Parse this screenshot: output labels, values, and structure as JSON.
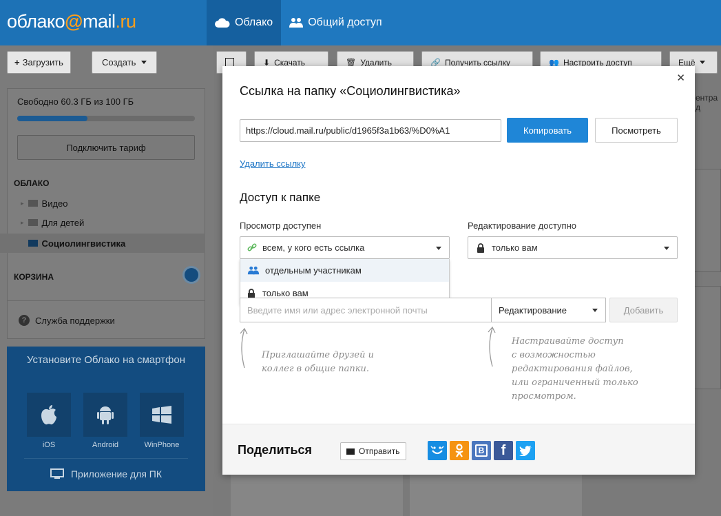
{
  "header": {
    "logo_prefix": "облако",
    "logo_at": "@",
    "logo_mail": "mail",
    "logo_ru": ".ru",
    "nav": [
      {
        "label": "Облако",
        "icon": "cloud-icon"
      },
      {
        "label": "Общий доступ",
        "icon": "people-icon"
      }
    ]
  },
  "sidebar": {
    "upload_label": "Загрузить",
    "create_label": "Создать",
    "storage_text": "Свободно 60.3 ГБ из 100 ГБ",
    "storage_used_fraction": 0.397,
    "tariff_label": "Подключить тариф",
    "cloud_title": "ОБЛАКО",
    "folders": [
      {
        "label": "Видео",
        "selected": false
      },
      {
        "label": "Для детей",
        "selected": false
      },
      {
        "label": "Социолингвистика",
        "selected": true
      }
    ],
    "trash_title": "КОРЗИНА",
    "support_label": "Служба поддержки",
    "promo": {
      "title": "Установите Облако на смартфон",
      "platforms": [
        "iOS",
        "Android",
        "WinPhone"
      ],
      "pc_label": "Приложение для ПК"
    }
  },
  "toolbar": {
    "download_label": "Скачать",
    "delete_label": "Удалить",
    "get_link_label": "Получить ссылку",
    "access_label": "Настроить доступ",
    "more_label": "Ещё",
    "side_text": "ентра д"
  },
  "modal": {
    "title": "Ссылка на папку «Социолингвистика»",
    "url": "https://cloud.mail.ru/public/d1965f3a1b63/%D0%A1",
    "copy_label": "Копировать",
    "view_label": "Посмотреть",
    "delete_link_label": "Удалить ссылку",
    "access_title": "Доступ к папке",
    "view_access_label": "Просмотр доступен",
    "view_selected": "всем, у кого есть ссылка",
    "view_options": [
      "отдельным участникам",
      "только вам"
    ],
    "edit_access_label": "Редактирование доступно",
    "edit_selected": "только вам",
    "email_placeholder": "Введите имя или адрес электронной почты",
    "permission_selected": "Редактирование",
    "add_label": "Добавить",
    "hint_left": "Приглашайте друзей и\nколлег в общие папки.",
    "hint_right": "Настраивайте доступ\nс возможностью\nредактирования файлов,\nили ограниченный только\nпросмотром.",
    "share_title": "Поделиться",
    "send_label": "Отправить",
    "social": [
      {
        "name": "mail-ru-smile-icon",
        "color": "#168de2"
      },
      {
        "name": "odnoklassniki-icon",
        "color": "#f59311"
      },
      {
        "name": "vkontakte-icon",
        "color": "#4b77be",
        "glyph": "В"
      },
      {
        "name": "facebook-icon",
        "color": "#3b5998",
        "glyph": "f"
      },
      {
        "name": "twitter-icon",
        "color": "#1da1f2"
      }
    ]
  },
  "colors": {
    "brand_blue": "#168de2",
    "accent_orange": "#ff9e1a",
    "link": "#1b74c5"
  }
}
